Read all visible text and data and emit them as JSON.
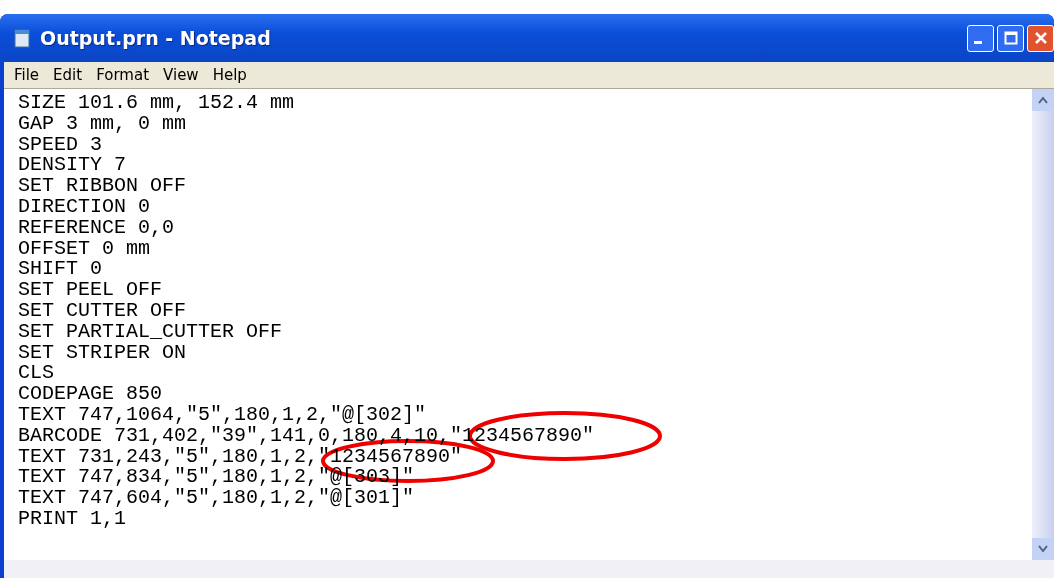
{
  "window": {
    "title": "Output.prn - Notepad"
  },
  "menu": [
    {
      "label": "File"
    },
    {
      "label": "Edit"
    },
    {
      "label": "Format"
    },
    {
      "label": "View"
    },
    {
      "label": "Help"
    }
  ],
  "lines": [
    "SIZE 101.6 mm, 152.4 mm",
    "GAP 3 mm, 0 mm",
    "SPEED 3",
    "DENSITY 7",
    "SET RIBBON OFF",
    "DIRECTION 0",
    "REFERENCE 0,0",
    "OFFSET 0 mm",
    "SHIFT 0",
    "SET PEEL OFF",
    "SET CUTTER OFF",
    "SET PARTIAL_CUTTER OFF",
    "SET STRIPER ON",
    "CLS",
    "CODEPAGE 850",
    "TEXT 747,1064,\"5\",180,1,2,\"@[302]\"",
    "BARCODE 731,402,\"39\",141,0,180,4,10,\"1234567890\"",
    "TEXT 731,243,\"5\",180,1,2,\"1234567890\"",
    "TEXT 747,834,\"5\",180,1,2,\"@[303]\"",
    "TEXT 747,604,\"5\",180,1,2,\"@[301]\"",
    "PRINT 1,1"
  ]
}
